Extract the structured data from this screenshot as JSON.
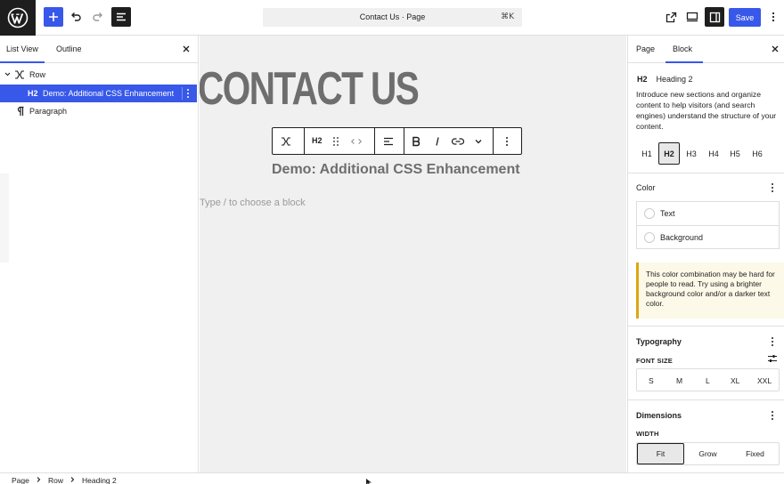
{
  "topbar": {
    "document_title": "Contact Us · Page",
    "shortcut": "⌘K",
    "save_label": "Save"
  },
  "left_panel": {
    "tabs": [
      "List View",
      "Outline"
    ],
    "active_tab": "List View",
    "tree": [
      {
        "label": "Row",
        "level": 0,
        "selected": false
      },
      {
        "tag": "H2",
        "label": "Demo: Additional CSS Enhancement",
        "level": 1,
        "selected": true
      },
      {
        "label": "Paragraph",
        "level": 1,
        "selected": false
      }
    ]
  },
  "canvas": {
    "page_heading": "CONTACT US",
    "toolbar_heading_level": "H2",
    "heading2_text": "Demo: Additional CSS Enhancement",
    "placeholder": "Type / to choose a block"
  },
  "right_panel": {
    "tabs": [
      "Page",
      "Block"
    ],
    "active_tab": "Block",
    "block_tag": "H2",
    "block_name": "Heading 2",
    "block_description": "Introduce new sections and organize content to help visitors (and search engines) understand the structure of your content.",
    "heading_levels": [
      "H1",
      "H2",
      "H3",
      "H4",
      "H5",
      "H6"
    ],
    "active_level": "H2",
    "color": {
      "title": "Color",
      "items": [
        "Text",
        "Background"
      ]
    },
    "contrast_notice": "This color combination may be hard for people to read. Try using a brighter background color and/or a darker text color.",
    "typography": {
      "title": "Typography",
      "font_size_label": "FONT SIZE",
      "sizes": [
        "S",
        "M",
        "L",
        "XL",
        "XXL"
      ]
    },
    "dimensions": {
      "title": "Dimensions",
      "width_label": "WIDTH",
      "options": [
        "Fit",
        "Grow",
        "Fixed"
      ],
      "active": "Fit"
    }
  },
  "footer": {
    "breadcrumbs": [
      "Page",
      "Row",
      "Heading 2"
    ]
  },
  "colors": {
    "accent": "#3858e9",
    "dark": "#1e1e1e",
    "canvas_bg": "#f0f0f0",
    "notice_border": "#dba617"
  }
}
